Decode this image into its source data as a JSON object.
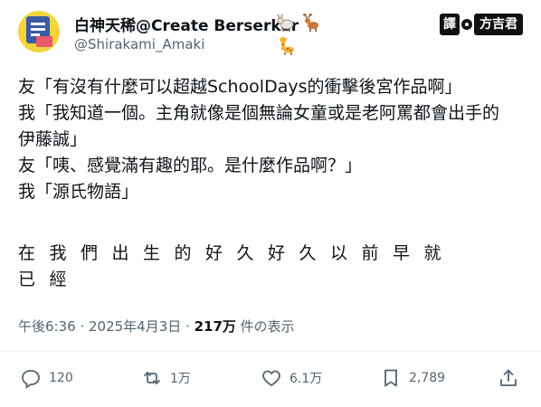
{
  "author": {
    "display_name": "白神天稀@Create Berserker",
    "handle": "@Shirakami_Amaki",
    "emoji": [
      "goat-emoji",
      "deer-emoji",
      "giraffe-emoji"
    ]
  },
  "translator_badge": {
    "left": "譯",
    "right": "方吉君"
  },
  "post": {
    "lines": [
      "友「有沒有什麼可以超越SchoolDays的衝擊後宮作品啊」",
      "我「我知道一個。主角就像是個無論女童或是老阿罵都會出手的",
      "伊藤誠」",
      "友「咦、感覺滿有趣的耶。是什麼作品啊？」",
      "我「源氏物語」"
    ],
    "spaced_lines": [
      "在我們出生的好久好久以前早就",
      "已經"
    ]
  },
  "meta": {
    "time": "午後6:36",
    "sep1": " · ",
    "date": "2025年4月3日",
    "sep2": " · ",
    "views": "217万",
    "views_label": " 件の表示"
  },
  "actions": {
    "reply_count": "120",
    "repost_count": "1万",
    "like_count": "6.1万",
    "bookmark_count": "2,789"
  },
  "colors": {
    "text": "#0f1419",
    "muted": "#536471",
    "divider": "#eff3f4"
  }
}
